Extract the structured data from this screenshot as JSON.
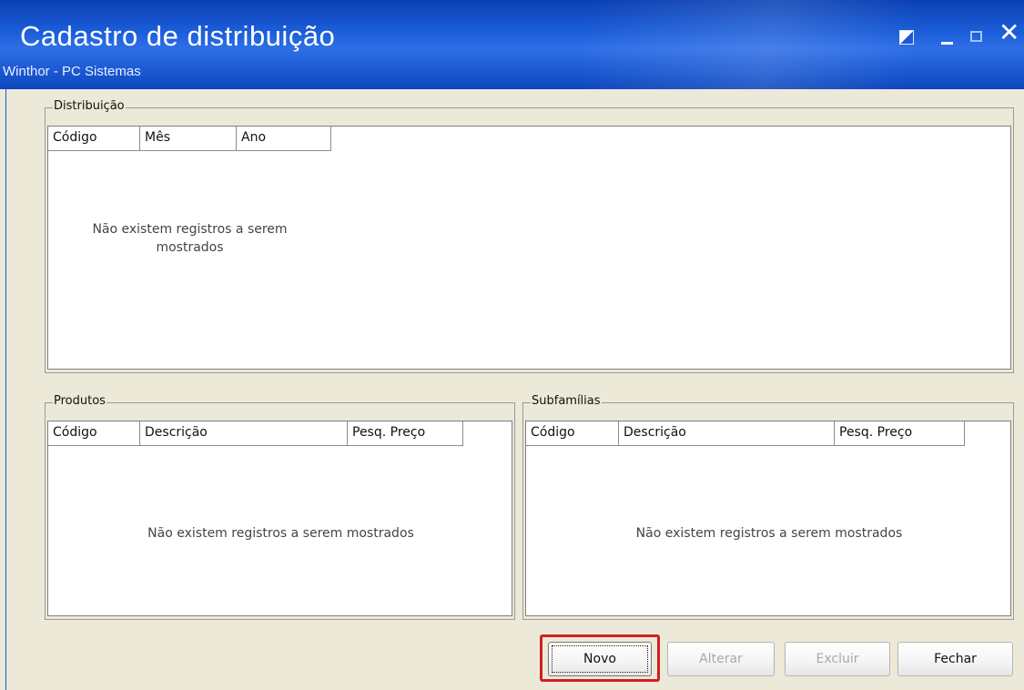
{
  "window": {
    "title": "Cadastro de distribuição",
    "subtitle": "Winthor - PC Sistemas"
  },
  "distribuicao": {
    "label": "Distribuição",
    "columns": [
      "Código",
      "Mês",
      "Ano"
    ],
    "empty_message": "Não existem registros a serem\nmostrados"
  },
  "produtos": {
    "label": "Produtos",
    "columns": [
      "Código",
      "Descrição",
      "Pesq. Preço"
    ],
    "empty_message": "Não existem registros a serem mostrados"
  },
  "subfamilias": {
    "label": "Subfamílias",
    "columns": [
      "Código",
      "Descrição",
      "Pesq. Preço"
    ],
    "empty_message": "Não existem registros a serem mostrados"
  },
  "buttons": {
    "novo": "Novo",
    "alterar": "Alterar",
    "excluir": "Excluir",
    "fechar": "Fechar"
  },
  "colors": {
    "titlebar": "#1b5dd9",
    "highlight": "#d21f1f",
    "face": "#ece9d8"
  }
}
